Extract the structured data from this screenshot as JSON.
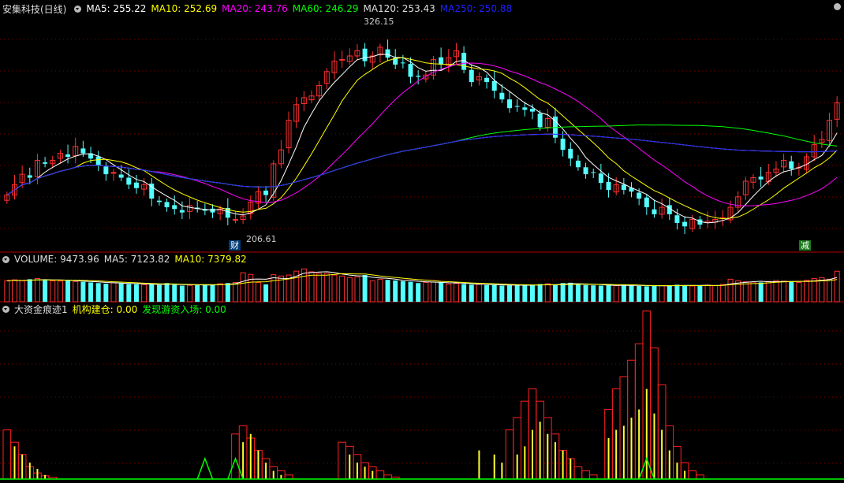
{
  "title": "安集科技(日线)",
  "ma": [
    {
      "label": "MA5: 255.22",
      "color": "#ffffff"
    },
    {
      "label": "MA10: 252.69",
      "color": "#ffff00"
    },
    {
      "label": "MA20: 243.76",
      "color": "#ff00ff"
    },
    {
      "label": "MA60: 246.29",
      "color": "#00ff00"
    },
    {
      "label": "MA120: 253.43",
      "color": "#dddddd"
    },
    {
      "label": "MA250: 250.88",
      "color": "#2020ff"
    }
  ],
  "high_label": "326.15",
  "low_label": "206.61",
  "tag_cai": "财",
  "tag_jian": "减",
  "volume_header": {
    "name": "VOLUME: 9473.96",
    "ma5": "MA5: 7123.82",
    "ma10": "MA10: 7379.82"
  },
  "indicator_header": {
    "name": "大资金痕迹1",
    "s1": "机构建仓: 0.00",
    "s2": "发现游资入场: 0.00"
  },
  "colors": {
    "up": "#ff3030",
    "down": "#54ffff",
    "ma5": "#ffffff",
    "ma10": "#ffff00",
    "ma20": "#ff00ff",
    "ma60": "#00ff00",
    "ma120": "#dddddd",
    "ma250": "#2020ff",
    "grid": "#7a0000",
    "ind_box": "#ff2020",
    "ind_bar": "#ffff30",
    "ind_peak": "#00ff00"
  },
  "chart_data": {
    "type": "candlestick",
    "price_range": [
      200,
      330
    ],
    "closes": [
      226,
      232,
      238,
      236,
      246,
      244,
      246,
      250,
      248,
      254,
      250,
      247,
      243,
      238,
      239,
      236,
      232,
      230,
      232,
      224,
      222,
      219,
      218,
      216,
      220,
      218,
      217,
      216,
      218,
      213,
      212,
      214,
      222,
      228,
      226,
      244,
      252,
      269,
      278,
      282,
      283,
      289,
      297,
      303,
      304,
      306,
      309,
      303,
      306,
      311,
      305,
      301,
      302,
      294,
      294,
      295,
      304,
      301,
      305,
      309,
      298,
      291,
      294,
      291,
      286,
      281,
      276,
      277,
      275,
      274,
      265,
      270,
      259,
      252,
      247,
      242,
      238,
      239,
      233,
      229,
      232,
      229,
      228,
      224,
      219,
      215,
      219,
      215,
      210,
      208,
      212,
      209,
      211,
      212,
      213,
      219,
      225,
      234,
      236,
      235,
      239,
      241,
      246,
      241,
      242,
      248,
      255,
      258,
      269,
      279
    ],
    "volume_range": [
      0,
      11000
    ],
    "volumes": [
      6500,
      6800,
      6500,
      7000,
      7200,
      6800,
      6500,
      6400,
      6600,
      6300,
      6200,
      6000,
      5800,
      5600,
      5900,
      5700,
      5500,
      5400,
      5300,
      5500,
      5200,
      5800,
      5300,
      5000,
      5100,
      5200,
      5400,
      5300,
      5600,
      5800,
      6000,
      9000,
      8500,
      6000,
      5400,
      8400,
      8000,
      8300,
      9500,
      10200,
      9300,
      8800,
      8800,
      8300,
      8000,
      7500,
      7700,
      8300,
      6500,
      7000,
      6800,
      6600,
      6400,
      6200,
      5800,
      6000,
      6100,
      6000,
      5500,
      5700,
      5500,
      5300,
      5400,
      5200,
      5200,
      5000,
      5100,
      5300,
      5100,
      5200,
      5500,
      5600,
      5300,
      5800,
      5900,
      5400,
      5200,
      5100,
      5000,
      5100,
      5000,
      5200,
      5100,
      4900,
      4800,
      4900,
      5000,
      5100,
      5300,
      5100,
      4900,
      5000,
      5200,
      5000,
      5400,
      7000,
      6500,
      6200,
      6100,
      6000,
      6300,
      6600,
      6400,
      6200,
      6000,
      6600,
      7200,
      7500,
      7000,
      9473.96
    ],
    "indicator_range": [
      0,
      40
    ],
    "ind_boxes": [
      [
        0,
        6
      ],
      [
        1,
        5
      ],
      [
        2,
        3
      ],
      [
        3,
        2
      ],
      [
        4,
        1
      ],
      [
        5,
        0.5
      ],
      [
        6,
        0.5
      ],
      [
        7,
        0.5
      ],
      [
        8,
        0.3
      ],
      [
        9,
        0.2
      ],
      [
        30,
        5
      ],
      [
        31,
        7
      ],
      [
        32,
        8
      ],
      [
        33,
        6
      ],
      [
        34,
        4
      ],
      [
        35,
        3
      ],
      [
        36,
        2
      ],
      [
        37,
        1
      ],
      [
        38,
        0.5
      ],
      [
        39,
        0.3
      ],
      [
        40,
        0.2
      ],
      [
        41,
        0.2
      ],
      [
        42,
        0.1
      ],
      [
        43,
        0.1
      ],
      [
        44,
        0.1
      ],
      [
        45,
        0.1
      ],
      [
        46,
        0.1
      ],
      [
        47,
        0.1
      ],
      [
        48,
        0.1
      ],
      [
        49,
        0.1
      ],
      [
        50,
        0.1
      ],
      [
        51,
        0.1
      ],
      [
        52,
        0.1
      ],
      [
        53,
        0.1
      ],
      [
        54,
        0.1
      ],
      [
        55,
        0.1
      ],
      [
        56,
        0.1
      ],
      [
        57,
        0.1
      ],
      [
        58,
        0.1
      ],
      [
        59,
        0.1
      ],
      [
        60,
        0.1
      ],
      [
        61,
        0.1
      ],
      [
        62,
        0.1
      ],
      [
        63,
        0.1
      ],
      [
        64,
        0.1
      ],
      [
        65,
        0.1
      ],
      [
        66,
        0.1
      ],
      [
        67,
        0.1
      ],
      [
        68,
        0.1
      ],
      [
        69,
        0.1
      ],
      [
        70,
        0.1
      ],
      [
        71,
        0.1
      ],
      [
        72,
        0.1
      ],
      [
        73,
        0.1
      ],
      [
        74,
        0.1
      ],
      [
        75,
        0.1
      ],
      [
        76,
        0.1
      ],
      [
        77,
        0.1
      ],
      [
        78,
        0.1
      ],
      [
        79,
        0.1
      ],
      [
        80,
        0.1
      ],
      [
        81,
        0.1
      ],
      [
        82,
        0.1
      ],
      [
        83,
        0.1
      ],
      [
        84,
        0.1
      ],
      [
        85,
        0.1
      ],
      [
        86,
        0.1
      ],
      [
        87,
        0.1
      ],
      [
        88,
        0.1
      ],
      [
        89,
        0.1
      ],
      [
        90,
        0.1
      ],
      [
        91,
        0.1
      ],
      [
        92,
        0.1
      ],
      [
        93,
        0.1
      ],
      [
        94,
        0.1
      ],
      [
        95,
        0.1
      ],
      [
        96,
        0.1
      ],
      [
        97,
        0.1
      ],
      [
        98,
        0.1
      ],
      [
        99,
        0.1
      ],
      [
        100,
        0.1
      ],
      [
        101,
        0.1
      ],
      [
        102,
        0.1
      ],
      [
        103,
        0.1
      ],
      [
        104,
        0.1
      ],
      [
        105,
        0.1
      ],
      [
        106,
        0.1
      ],
      [
        107,
        0.1
      ],
      [
        108,
        0.1
      ],
      [
        109,
        0.1
      ]
    ],
    "ind_blocks": [
      {
        "start": 0,
        "heights": [
          12,
          9,
          6,
          3,
          1.5,
          0.8,
          0.4
        ]
      },
      {
        "start": 30,
        "heights": [
          11,
          13,
          10,
          7,
          5,
          3,
          2,
          1
        ]
      },
      {
        "start": 44,
        "heights": [
          9,
          8,
          6,
          4,
          3,
          2,
          1,
          0.5
        ]
      },
      {
        "start": 66,
        "heights": [
          12,
          15,
          19,
          22,
          19,
          15,
          11,
          7,
          5,
          3,
          2,
          1
        ]
      },
      {
        "start": 79,
        "heights": [
          17,
          22,
          25,
          29,
          33,
          41,
          32,
          23,
          13,
          8,
          4,
          2,
          1
        ]
      }
    ],
    "ind_bars": [
      {
        "start": 1,
        "heights": [
          8,
          6,
          4,
          2.5,
          1
        ]
      },
      {
        "start": 31,
        "heights": [
          9,
          11,
          7,
          4,
          2,
          1
        ]
      },
      {
        "start": 45,
        "heights": [
          6,
          4,
          3,
          2
        ]
      },
      {
        "start": 62,
        "heights": [
          7,
          0,
          6,
          4,
          0,
          6,
          8,
          12,
          14,
          11,
          9,
          7,
          5
        ]
      },
      {
        "start": 79,
        "heights": [
          10,
          12,
          13,
          15,
          17,
          22,
          16,
          12,
          7,
          4,
          2
        ]
      }
    ],
    "ind_peaks": [
      26,
      30,
      84
    ],
    "ind_peak_height": 5
  }
}
